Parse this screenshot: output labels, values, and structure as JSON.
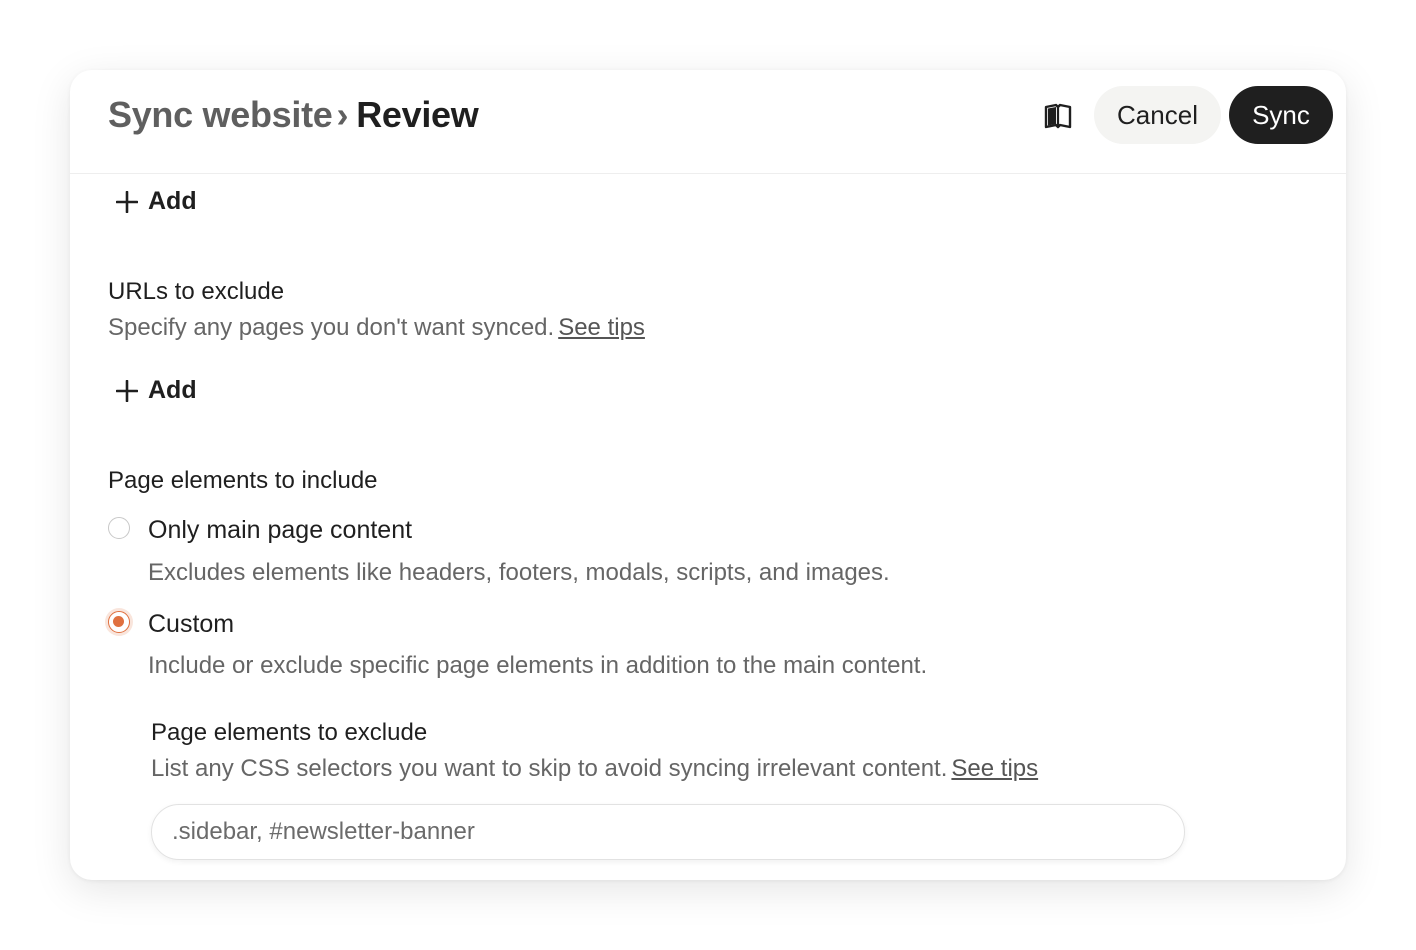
{
  "header": {
    "breadcrumb_parent": "Sync website",
    "breadcrumb_separator": "›",
    "breadcrumb_current": "Review",
    "docs_icon": "book-open-icon",
    "cancel_label": "Cancel",
    "sync_label": "Sync"
  },
  "include_urls": {
    "add_label": "Add",
    "add_icon": "plus-icon"
  },
  "exclude_urls": {
    "title": "URLs to exclude",
    "description": "Specify any pages you don't want synced.",
    "tips_link": "See tips",
    "add_label": "Add",
    "add_icon": "plus-icon"
  },
  "page_elements": {
    "title": "Page elements to include",
    "options": [
      {
        "label": "Only main page content",
        "description": "Excludes elements like headers, footers, modals, scripts, and images.",
        "selected": false
      },
      {
        "label": "Custom",
        "description": "Include or exclude specific page elements in addition to the main content.",
        "selected": true
      }
    ]
  },
  "exclude_elements": {
    "title": "Page elements to exclude",
    "description": "List any CSS selectors you want to skip to avoid syncing irrelevant content.",
    "tips_link": "See tips",
    "placeholder": ".sidebar, #newsletter-banner",
    "value": ""
  },
  "colors": {
    "accent": "#e0703f",
    "primary_button": "#1f1f1f",
    "secondary_button": "#f4f4f2"
  }
}
